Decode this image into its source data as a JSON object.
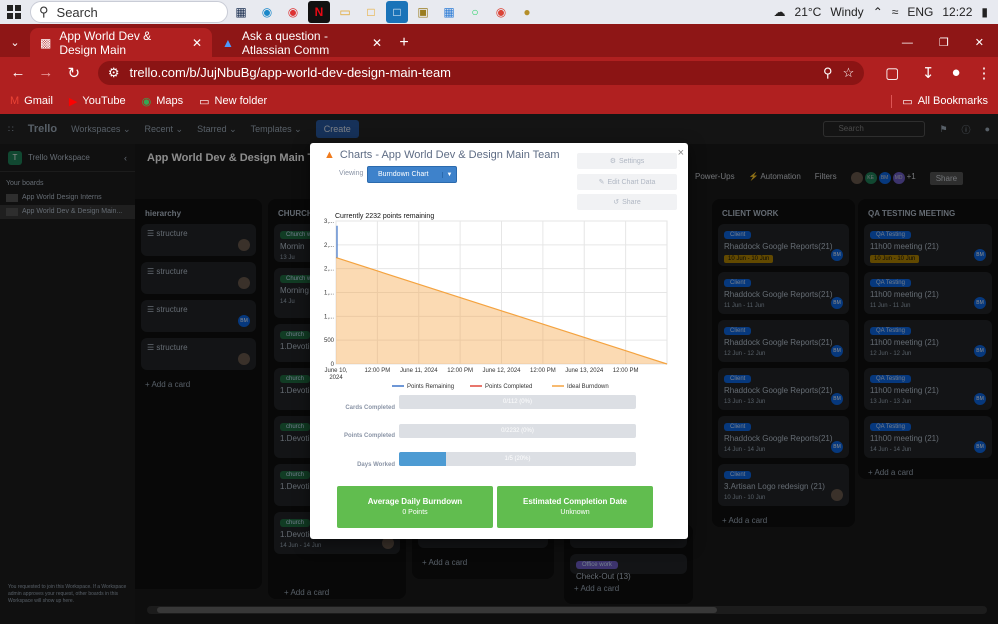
{
  "taskbar": {
    "search_label": "Search",
    "weather": "21°C",
    "weather_desc": "Windy",
    "lang": "ENG",
    "time": "12:22"
  },
  "browser": {
    "tabs": [
      {
        "title": "App World Dev & Design Main"
      },
      {
        "title": "Ask a question - Atlassian Comm"
      }
    ],
    "url": "trello.com/b/JujNbuBg/app-world-dev-design-main-team",
    "bookmarks": [
      "Gmail",
      "YouTube",
      "Maps",
      "New folder"
    ],
    "all_bookmarks": "All Bookmarks"
  },
  "trello": {
    "logo": "Trello",
    "menus": [
      "Workspaces",
      "Recent",
      "Starred",
      "Templates"
    ],
    "create": "Create",
    "search_placeholder": "Search",
    "board_title": "App World Dev & Design Main Team",
    "board_actions": [
      "Power-Ups",
      "Automation",
      "Filters",
      "Share"
    ],
    "member_more": "+1"
  },
  "sidebar": {
    "workspace": "Trello Workspace",
    "your_boards": "Your boards",
    "boards": [
      "App World Design Interns",
      "App World Dev & Design Main..."
    ],
    "notice": "You requested to join this Workspace. If a Workspace admin approves your request, other boards in this Workspace will show up here."
  },
  "lists": {
    "hierarchy": {
      "title": "hierarchy",
      "cards": [
        "structure",
        "structure",
        "structure",
        "structure"
      ],
      "add": "Add a card"
    },
    "church": {
      "title": "CHURCH",
      "cards": [
        {
          "badge": "Church w",
          "title": "Mornin",
          "due": "13 Ju"
        },
        {
          "badge": "Church w",
          "title": "Morning Meeting",
          "due": "14 Ju"
        },
        {
          "badge": "church",
          "title": "1.Devoti",
          "due": ""
        },
        {
          "badge": "church",
          "title": "1.Devoti",
          "due": ""
        },
        {
          "badge": "church",
          "title": "1.Devoti",
          "due": ""
        },
        {
          "badge": "church",
          "title": "1.Devoti",
          "due": ""
        },
        {
          "badge": "church",
          "title": "1.Devotio",
          "due": "14 Jun - 14 Jun"
        },
        {
          "badge": "church",
          "title": "",
          "due": ""
        }
      ],
      "add": "Add a card"
    },
    "col4": {
      "due": "14 Jun - 14 Jun",
      "add": "Add a card"
    },
    "col5": {
      "due": "11 Jun - 11 Jun",
      "badge": "Office work",
      "title": "Check-Out (13)",
      "add": "Add a card"
    },
    "client": {
      "title": "CLIENT WORK",
      "cards": [
        {
          "badge": "Client",
          "title": "Rhaddock Google Reports(21)",
          "due": "10 Jun - 10 Jun"
        },
        {
          "badge": "Client",
          "title": "Rhaddock Google Reports(21)",
          "due": "11 Jun - 11 Jun"
        },
        {
          "badge": "Client",
          "title": "Rhaddock Google Reports(21)",
          "due": "12 Jun - 12 Jun"
        },
        {
          "badge": "Client",
          "title": "Rhaddock Google Reports(21)",
          "due": "13 Jun - 13 Jun"
        },
        {
          "badge": "Client",
          "title": "Rhaddock Google Reports(21)",
          "due": "14 Jun - 14 Jun"
        },
        {
          "badge": "Client",
          "title": "3.Artisan Logo redesign (21)",
          "due": "10 Jun - 10 Jun"
        }
      ],
      "add": "Add a card"
    },
    "qa": {
      "title": "QA TESTING MEETING",
      "cards": [
        {
          "badge": "QA Testing",
          "title": "11h00 meeting (21)",
          "due": "10 Jun - 10 Jun"
        },
        {
          "badge": "QA Testing",
          "title": "11h00 meeting (21)",
          "due": "11 Jun - 11 Jun"
        },
        {
          "badge": "QA Testing",
          "title": "11h00 meeting (21)",
          "due": "12 Jun - 12 Jun"
        },
        {
          "badge": "QA Testing",
          "title": "11h00 meeting (21)",
          "due": "13 Jun - 13 Jun"
        },
        {
          "badge": "QA Testing",
          "title": "11h00 meeting (21)",
          "due": "14 Jun - 14 Jun"
        }
      ],
      "add": "Add a card"
    },
    "avatar_bm": "BM"
  },
  "modal": {
    "title": "Charts - App World Dev & Design Main Team",
    "viewing": "Viewing",
    "chart_select": "Burndown Chart",
    "settings": "Settings",
    "edit_chart_data": "Edit Chart Data",
    "share": "Share",
    "close": "×",
    "stats": [
      {
        "label": "Cards Completed",
        "value": "0/112 (0%)",
        "fraction": 0
      },
      {
        "label": "Points Completed",
        "value": "0/2232 (0%)",
        "fraction": 0
      },
      {
        "label": "Days Worked",
        "value": "1/5 (20%)",
        "fraction": 0.2
      }
    ],
    "avg_daily": {
      "title": "Average Daily Burndown",
      "value": "0 Points"
    },
    "est_completion": {
      "title": "Estimated Completion Date",
      "value": "Unknown"
    }
  },
  "chart_data": {
    "type": "area",
    "title": "Currently 2232 points remaining",
    "x_tick_labels": [
      "June 10, 2024",
      "12:00 PM",
      "June 11, 2024",
      "12:00 PM",
      "June 12, 2024",
      "12:00 PM",
      "June 13, 2024",
      "12:00 PM"
    ],
    "y_tick_labels": [
      "0",
      "500",
      "1,...",
      "1,...",
      "2,...",
      "2,...",
      "3,..."
    ],
    "ylim": [
      0,
      3000
    ],
    "x": [
      0,
      4
    ],
    "series": [
      {
        "name": "Points Remaining",
        "color": "#3e74c9",
        "x": [
          0,
          0
        ],
        "values": [
          2232,
          2900
        ]
      },
      {
        "name": "Points Completed",
        "color": "#e0483b",
        "x": [],
        "values": []
      },
      {
        "name": "Ideal Burndown",
        "color": "#f4a340",
        "x": [
          0,
          4
        ],
        "values": [
          2232,
          0
        ]
      }
    ],
    "legend_position": "bottom",
    "grid": true
  }
}
